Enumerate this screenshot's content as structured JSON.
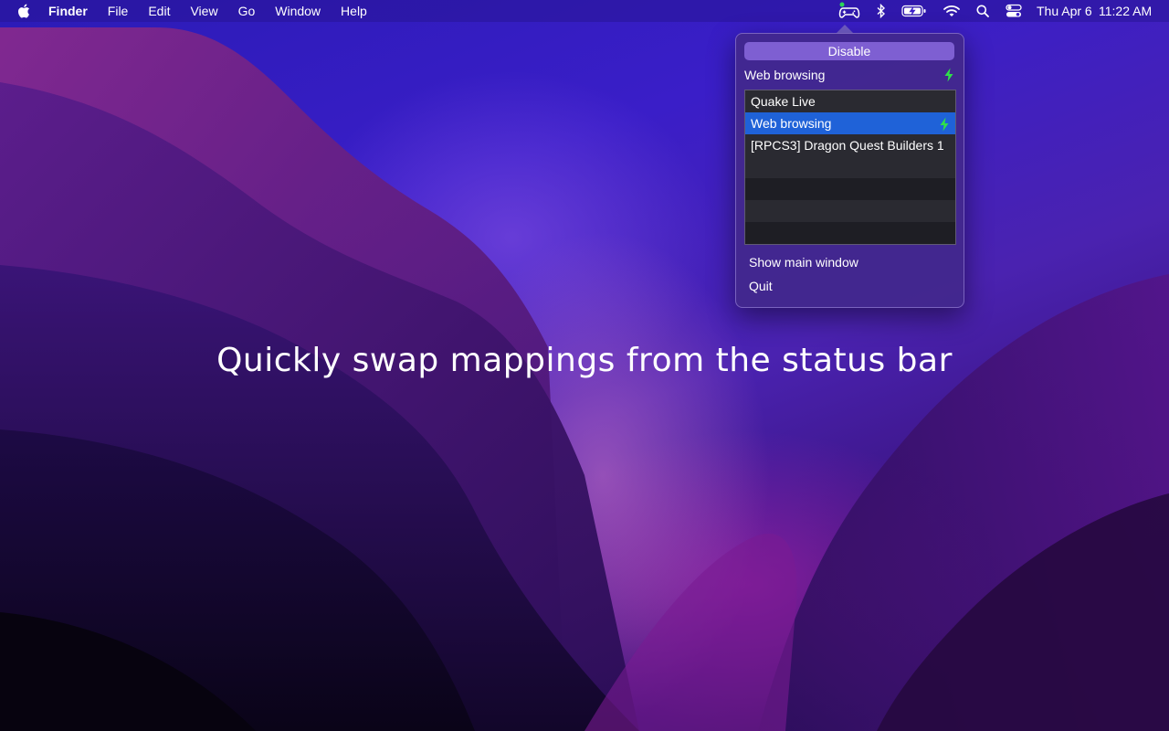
{
  "menubar": {
    "apple_icon": "apple-logo-icon",
    "app_name": "Finder",
    "menus": [
      "File",
      "Edit",
      "View",
      "Go",
      "Window",
      "Help"
    ],
    "status_icons": [
      "gamepad-icon",
      "bluetooth-icon",
      "battery-charging-icon",
      "wifi-icon",
      "search-icon",
      "control-center-icon"
    ],
    "gamepad_indicator_color": "#2bd65a",
    "date": "Thu Apr 6",
    "time": "11:22 AM"
  },
  "popover": {
    "disable_label": "Disable",
    "current_mapping": "Web browsing",
    "current_active_icon": "lightning-bolt-icon",
    "bolt_color": "#2fe04a",
    "accent_color": "#1f62d8",
    "mappings": [
      {
        "label": "Quake Live",
        "selected": false,
        "active": false
      },
      {
        "label": "Web browsing",
        "selected": true,
        "active": true
      },
      {
        "label": "[RPCS3] Dragon Quest Builders 1",
        "selected": false,
        "active": false
      }
    ],
    "show_main_window_label": "Show main window",
    "quit_label": "Quit"
  },
  "headline": "Quickly swap mappings from the status bar"
}
